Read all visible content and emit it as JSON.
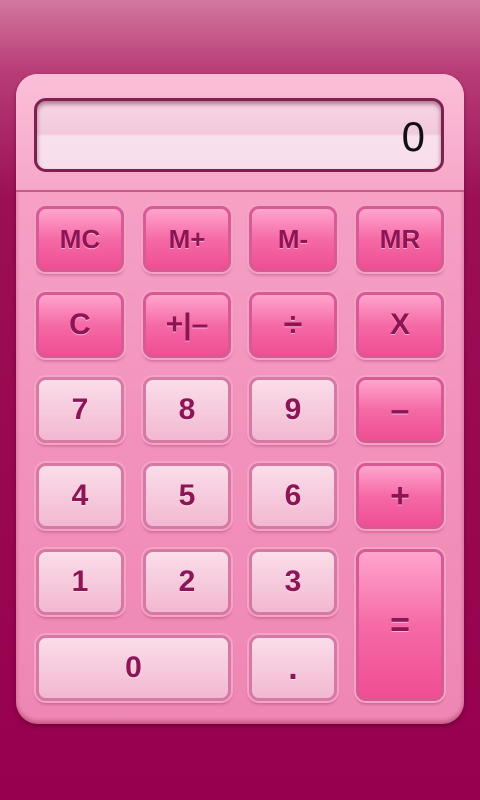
{
  "display": {
    "value": "0"
  },
  "buttons": {
    "mc": "MC",
    "mplus": "M+",
    "mminus": "M-",
    "mr": "MR",
    "clear": "C",
    "sign": "+|–",
    "divide": "÷",
    "multiply": "X",
    "seven": "7",
    "eight": "8",
    "nine": "9",
    "minus": "–",
    "four": "4",
    "five": "5",
    "six": "6",
    "plus": "+",
    "one": "1",
    "two": "2",
    "three": "3",
    "equals": "=",
    "zero": "0",
    "decimal": "."
  },
  "colors": {
    "background": "#97004f",
    "body": "#f394bd",
    "function_key": "#f56aa6",
    "number_key": "#f6c9dc",
    "key_text": "#8d1556"
  }
}
